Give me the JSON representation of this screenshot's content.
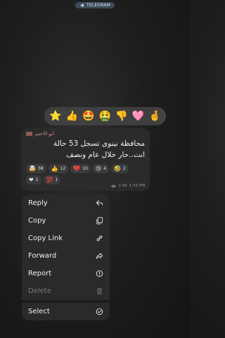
{
  "header": {
    "badge_label": "TELEGRAM"
  },
  "reaction_picker": {
    "emojis": [
      "⭐",
      "👍",
      "🤩",
      "🤮",
      "👎",
      "🩷",
      "🤞"
    ]
  },
  "message": {
    "sender": "ابو الاحمر",
    "text": "محافظة نينوى تسجل 53 حالة انت..حار خلال عام ونصف",
    "reactions": [
      {
        "emoji": "🤯",
        "count": "38"
      },
      {
        "emoji": "👍",
        "count": "12"
      },
      {
        "emoji": "💔",
        "count": "10"
      },
      {
        "emoji": "😢",
        "count": "4"
      },
      {
        "emoji": "🤣",
        "count": "2"
      },
      {
        "emoji": "❤",
        "count": "1"
      },
      {
        "emoji": "💯",
        "count": "1"
      }
    ],
    "views": "1.5K",
    "time": "1:31 PM"
  },
  "context_menu": {
    "items": [
      {
        "label": "Reply",
        "icon": "reply-icon"
      },
      {
        "label": "Copy",
        "icon": "copy-icon"
      },
      {
        "label": "Copy Link",
        "icon": "link-icon"
      },
      {
        "label": "Forward",
        "icon": "forward-icon"
      },
      {
        "label": "Report",
        "icon": "report-icon"
      },
      {
        "label": "Delete",
        "icon": "trash-icon",
        "disabled": true
      },
      {
        "label": "Select",
        "icon": "check-circle-icon"
      }
    ]
  }
}
